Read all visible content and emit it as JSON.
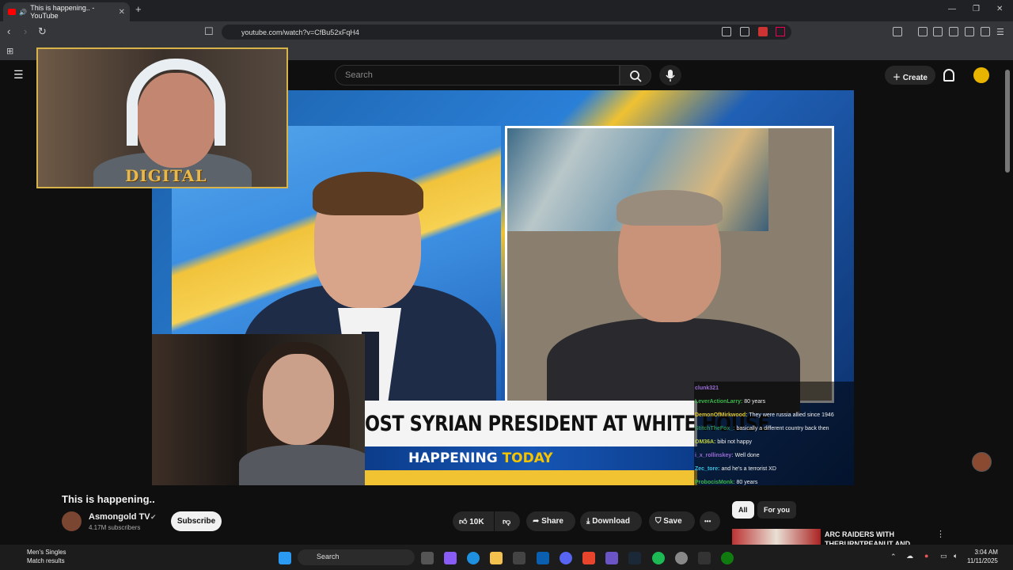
{
  "browser": {
    "tab_title": "This is happening.. - YouTube",
    "url": "youtube.com/watch?v=CfBu52xFqH4"
  },
  "youtube": {
    "search_placeholder": "Search",
    "create_label": "Create"
  },
  "video": {
    "lower_third": "OST SYRIAN PRESIDENT AT WHITE HOUSE",
    "ticker_part1": "HAPPENING ",
    "ticker_part2": "TODAY",
    "overlay_logo": "DIGITAL"
  },
  "chat": [
    {
      "user": "clunk321",
      "text": "",
      "color": "#9a6cd6"
    },
    {
      "user": "LeverActionLarry:",
      "text": "80 years",
      "color": "#3bb54a"
    },
    {
      "user": "DemonOfMirkwood:",
      "text": "They were russia allied since 1946",
      "color": "#e0c020"
    },
    {
      "user": "StitchTheFox_:",
      "text": "basically a different country back then",
      "color": "#2e8b57"
    },
    {
      "user": "OM36A:",
      "text": "bibi not happy",
      "color": "#c0d040"
    },
    {
      "user": "i_x_rollinskey:",
      "text": "Well done",
      "color": "#9a6cd6"
    },
    {
      "user": "Zec_tore:",
      "text": "and he's a terrorist XD",
      "color": "#3ac0e0"
    },
    {
      "user": "ProbocisMonk:",
      "text": "80 years",
      "color": "#3bb54a"
    }
  ],
  "meta": {
    "title": "This is happening..",
    "channel": "Asmongold TV",
    "verified": "✔",
    "subscribers": "4.17M subscribers",
    "subscribe": "Subscribe",
    "likes": "10K",
    "share": "Share",
    "download": "Download",
    "save": "Save",
    "more": "•••"
  },
  "chips": {
    "all": "All",
    "for_you": "For you"
  },
  "recommendation": {
    "title": "ARC RAIDERS WITH THEBURNTPEANUT AND"
  },
  "taskbar": {
    "search": "Search",
    "notification_title": "Men's Singles",
    "notification_sub": "Match results",
    "time": "3:04 AM",
    "date": "11/11/2025"
  },
  "colors": {
    "accent_red": "#ff0000",
    "bg": "#0f0f0f"
  }
}
